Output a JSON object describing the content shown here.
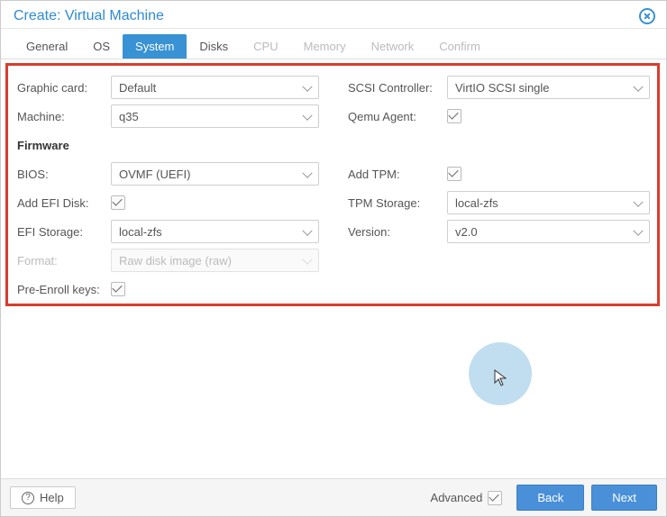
{
  "window": {
    "title": "Create: Virtual Machine"
  },
  "tabs": [
    {
      "label": "General",
      "state": "normal"
    },
    {
      "label": "OS",
      "state": "normal"
    },
    {
      "label": "System",
      "state": "active"
    },
    {
      "label": "Disks",
      "state": "normal"
    },
    {
      "label": "CPU",
      "state": "disabled"
    },
    {
      "label": "Memory",
      "state": "disabled"
    },
    {
      "label": "Network",
      "state": "disabled"
    },
    {
      "label": "Confirm",
      "state": "disabled"
    }
  ],
  "left": {
    "graphic_card": {
      "label": "Graphic card:",
      "value": "Default"
    },
    "machine": {
      "label": "Machine:",
      "value": "q35"
    },
    "firmware_header": "Firmware",
    "bios": {
      "label": "BIOS:",
      "value": "OVMF (UEFI)"
    },
    "add_efi": {
      "label": "Add EFI Disk:",
      "checked": true
    },
    "efi_storage": {
      "label": "EFI Storage:",
      "value": "local-zfs"
    },
    "format": {
      "label": "Format:",
      "value": "Raw disk image (raw)",
      "disabled": true
    },
    "pre_enroll": {
      "label": "Pre-Enroll keys:",
      "checked": true
    }
  },
  "right": {
    "scsi": {
      "label": "SCSI Controller:",
      "value": "VirtIO SCSI single"
    },
    "qemu_agent": {
      "label": "Qemu Agent:",
      "checked": true
    },
    "add_tpm": {
      "label": "Add TPM:",
      "checked": true
    },
    "tpm_storage": {
      "label": "TPM Storage:",
      "value": "local-zfs"
    },
    "tpm_version": {
      "label": "Version:",
      "value": "v2.0"
    }
  },
  "footer": {
    "help": "Help",
    "advanced_label": "Advanced",
    "advanced_checked": true,
    "back": "Back",
    "next": "Next"
  }
}
